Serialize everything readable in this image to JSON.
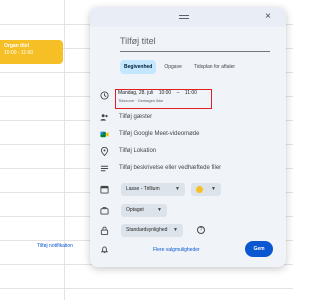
{
  "background_event": {
    "title": "Organ titel",
    "time": "10:00 - 11:00"
  },
  "dialog": {
    "close_glyph": "×",
    "title_placeholder": "Tilføj titel",
    "tabs": [
      {
        "label": "Begivenhed",
        "active": true
      },
      {
        "label": "Opgave",
        "active": false
      },
      {
        "label": "Tidsplan for aftaler",
        "active": false
      }
    ],
    "datetime": {
      "date": "Mandag, 28. juli",
      "start": "10:00",
      "dash": "–",
      "end": "11:00",
      "repeat": "Tidszone · Gentages ikke"
    },
    "rows": {
      "guests": "Tilføj gæster",
      "meet": "Tilføj Google Meet-videomøde",
      "location": "Tilføj Lokation",
      "description": "Tilføj beskrivelse eller vedhæftede filer"
    },
    "calendar_select": "Lasse - Trillium",
    "status_select": "Optaget",
    "visibility_select": "Standardsynlighed",
    "notification_link": "Tilføj notifikation",
    "more_options": "Flere valgmuligheder",
    "save": "Gem"
  },
  "colors": {
    "accent": "#0b57d0",
    "event_yellow": "#f6bf26",
    "highlight_red": "#e02020",
    "dialog_bg": "#f0f4f9"
  },
  "icons": {
    "clock": "clock-icon",
    "people": "people-icon",
    "meet": "meet-icon",
    "location": "location-pin-icon",
    "description": "description-lines-icon",
    "calendar": "calendar-icon",
    "briefcase": "briefcase-icon",
    "lock": "lock-icon",
    "help": "help-icon",
    "bell": "bell-icon"
  }
}
